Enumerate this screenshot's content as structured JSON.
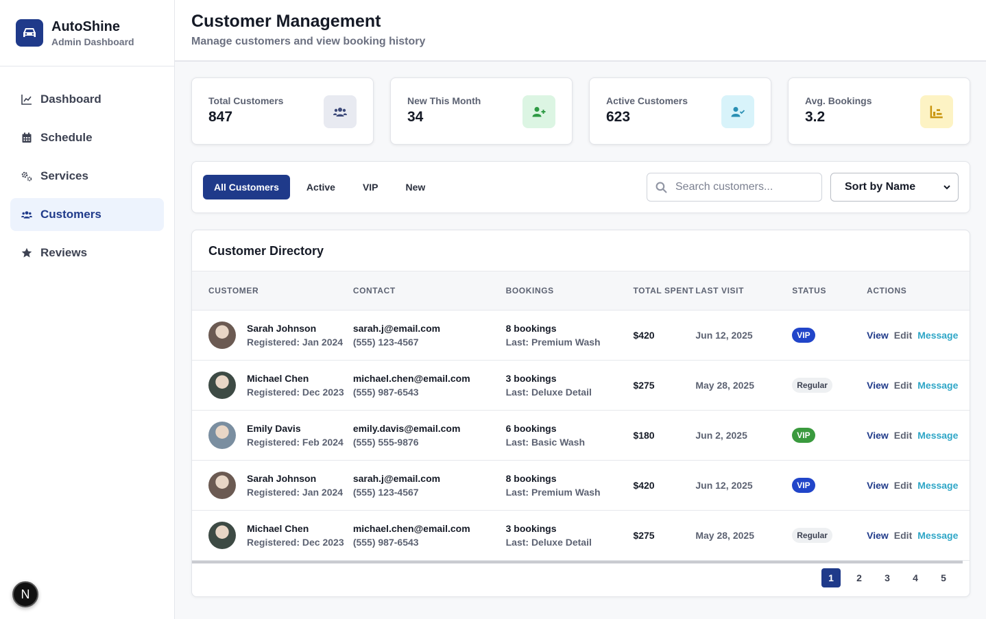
{
  "brand": {
    "name": "AutoShine",
    "subtitle": "Admin Dashboard"
  },
  "nav": [
    {
      "label": "Dashboard",
      "icon": "chart-line-icon"
    },
    {
      "label": "Schedule",
      "icon": "calendar-icon"
    },
    {
      "label": "Services",
      "icon": "gears-icon"
    },
    {
      "label": "Customers",
      "icon": "users-icon",
      "active": true
    },
    {
      "label": "Reviews",
      "icon": "star-icon"
    }
  ],
  "header": {
    "title": "Customer Management",
    "subtitle": "Manage customers and view booking history"
  },
  "stats": [
    {
      "label": "Total Customers",
      "value": "847",
      "icon": "users-icon",
      "color": "#3d4a7a",
      "bg": "#e8eaf1"
    },
    {
      "label": "New This Month",
      "value": "34",
      "icon": "user-plus-icon",
      "color": "#2e9a44",
      "bg": "#dcf5e3"
    },
    {
      "label": "Active Customers",
      "value": "623",
      "icon": "user-check-icon",
      "color": "#2a8fb3",
      "bg": "#d8f3fa"
    },
    {
      "label": "Avg. Bookings",
      "value": "3.2",
      "icon": "bar-chart-icon",
      "color": "#c9950f",
      "bg": "#fdf3c4"
    }
  ],
  "filters": {
    "tabs": [
      "All Customers",
      "Active",
      "VIP",
      "New"
    ],
    "search_placeholder": "Search customers...",
    "sort_label": "Sort by Name"
  },
  "table": {
    "title": "Customer Directory",
    "columns": [
      "CUSTOMER",
      "CONTACT",
      "BOOKINGS",
      "TOTAL SPENT",
      "LAST VISIT",
      "STATUS",
      "ACTIONS"
    ],
    "actions": {
      "view": "View",
      "edit": "Edit",
      "message": "Message"
    },
    "rows": [
      {
        "name": "Sarah Johnson",
        "registered": "Registered: Jan 2024",
        "email": "sarah.j@email.com",
        "phone": "(555) 123-4567",
        "bookings": "8 bookings",
        "last_service": "Last: Premium Wash",
        "spent": "$420",
        "last_visit": "Jun 12, 2025",
        "status": "VIP",
        "status_style": "vip",
        "avatar_bg": "#6b5a52"
      },
      {
        "name": "Michael Chen",
        "registered": "Registered: Dec 2023",
        "email": "michael.chen@email.com",
        "phone": "(555) 987-6543",
        "bookings": "3 bookings",
        "last_service": "Last: Deluxe Detail",
        "spent": "$275",
        "last_visit": "May 28, 2025",
        "status": "Regular",
        "status_style": "regular",
        "avatar_bg": "#3d4a44"
      },
      {
        "name": "Emily Davis",
        "registered": "Registered: Feb 2024",
        "email": "emily.davis@email.com",
        "phone": "(555) 555-9876",
        "bookings": "6 bookings",
        "last_service": "Last: Basic Wash",
        "spent": "$180",
        "last_visit": "Jun 2, 2025",
        "status": "VIP",
        "status_style": "vip-green",
        "avatar_bg": "#7a8ea0"
      },
      {
        "name": "Sarah Johnson",
        "registered": "Registered: Jan 2024",
        "email": "sarah.j@email.com",
        "phone": "(555) 123-4567",
        "bookings": "8 bookings",
        "last_service": "Last: Premium Wash",
        "spent": "$420",
        "last_visit": "Jun 12, 2025",
        "status": "VIP",
        "status_style": "vip",
        "avatar_bg": "#6b5a52"
      },
      {
        "name": "Michael Chen",
        "registered": "Registered: Dec 2023",
        "email": "michael.chen@email.com",
        "phone": "(555) 987-6543",
        "bookings": "3 bookings",
        "last_service": "Last: Deluxe Detail",
        "spent": "$275",
        "last_visit": "May 28, 2025",
        "status": "Regular",
        "status_style": "regular",
        "avatar_bg": "#3d4a44"
      }
    ]
  },
  "pagination": [
    "1",
    "2",
    "3",
    "4",
    "5"
  ],
  "dev_badge": "N"
}
